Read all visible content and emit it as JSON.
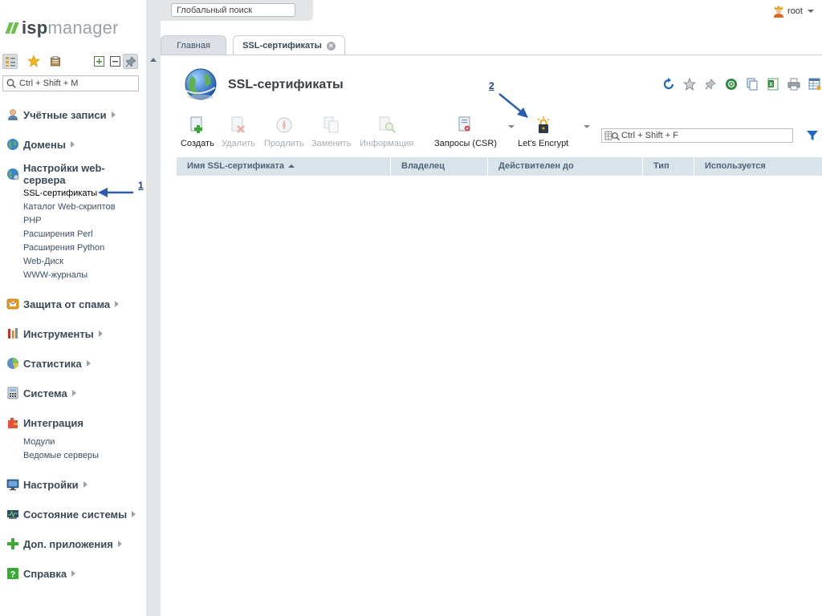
{
  "logo": {
    "part1": "isp",
    "part2": "manager"
  },
  "leftpanel": {
    "search_placeholder": "Ctrl + Shift + M",
    "groups": [
      {
        "label": "Учётные записи"
      },
      {
        "label": "Домены"
      },
      {
        "label": "Настройки web-сервера",
        "items": [
          "SSL-сертификаты",
          "Каталог Web-скриптов",
          "PHP",
          "Расширения Perl",
          "Расширения Python",
          "Web-Диск",
          "WWW-журналы"
        ]
      },
      {
        "label": "Защита от спама"
      },
      {
        "label": "Инструменты"
      },
      {
        "label": "Статистика"
      },
      {
        "label": "Система"
      },
      {
        "label": "Интеграция",
        "items": [
          "Модули",
          "Ведомые серверы"
        ]
      },
      {
        "label": "Настройки"
      },
      {
        "label": "Состояние системы"
      },
      {
        "label": "Доп. приложения"
      },
      {
        "label": "Справка"
      }
    ]
  },
  "header": {
    "global_search_placeholder": "Глобальный поиск",
    "user": "root"
  },
  "tabs": {
    "home": "Главная",
    "current": "SSL-сертификаты"
  },
  "page": {
    "title": "SSL-сертификаты"
  },
  "toolbar": {
    "create": "Создать",
    "delete": "Удалить",
    "renew": "Продлить",
    "replace": "Заменить",
    "info": "Информация",
    "csr": "Запросы (CSR)",
    "letsencrypt": "Let's Encrypt",
    "search_placeholder": "Ctrl + Shift + F"
  },
  "table": {
    "columns": [
      "Имя SSL-сертификата",
      "Владелец",
      "Действителен до",
      "Тип",
      "Используется"
    ]
  },
  "annotations": {
    "a1": "1",
    "a2": "2"
  },
  "colors": {
    "accent_green": "#6cbf4f",
    "header_bg": "#d9e3ea",
    "arrow_blue": "#2a5db0"
  }
}
